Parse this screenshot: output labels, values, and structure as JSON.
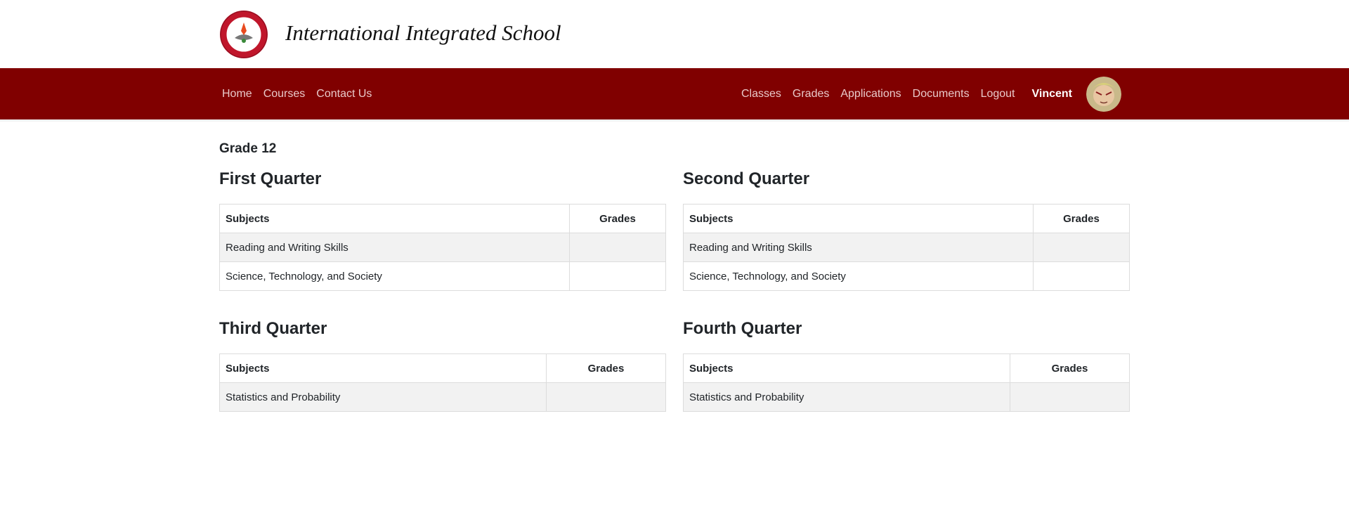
{
  "header": {
    "school_name": "International Integrated School",
    "logo_icon": "school-seal-icon"
  },
  "nav": {
    "left": [
      "Home",
      "Courses",
      "Contact Us"
    ],
    "right": [
      "Classes",
      "Grades",
      "Applications",
      "Documents",
      "Logout"
    ],
    "username": "Vincent",
    "colors": {
      "bar": "#800000",
      "link": "#e8c9c9"
    }
  },
  "page": {
    "title": "Grade 12"
  },
  "quarters": [
    {
      "title": "First Quarter",
      "headers": [
        "Subjects",
        "Grades"
      ],
      "rows": [
        {
          "subject": "Reading and Writing Skills",
          "grade": ""
        },
        {
          "subject": "Science, Technology, and Society",
          "grade": ""
        }
      ]
    },
    {
      "title": "Second Quarter",
      "headers": [
        "Subjects",
        "Grades"
      ],
      "rows": [
        {
          "subject": "Reading and Writing Skills",
          "grade": ""
        },
        {
          "subject": "Science, Technology, and Society",
          "grade": ""
        }
      ]
    },
    {
      "title": "Third Quarter",
      "headers": [
        "Subjects",
        "Grades"
      ],
      "rows": [
        {
          "subject": "Statistics and Probability",
          "grade": ""
        }
      ]
    },
    {
      "title": "Fourth Quarter",
      "headers": [
        "Subjects",
        "Grades"
      ],
      "rows": [
        {
          "subject": "Statistics and Probability",
          "grade": ""
        }
      ]
    }
  ]
}
